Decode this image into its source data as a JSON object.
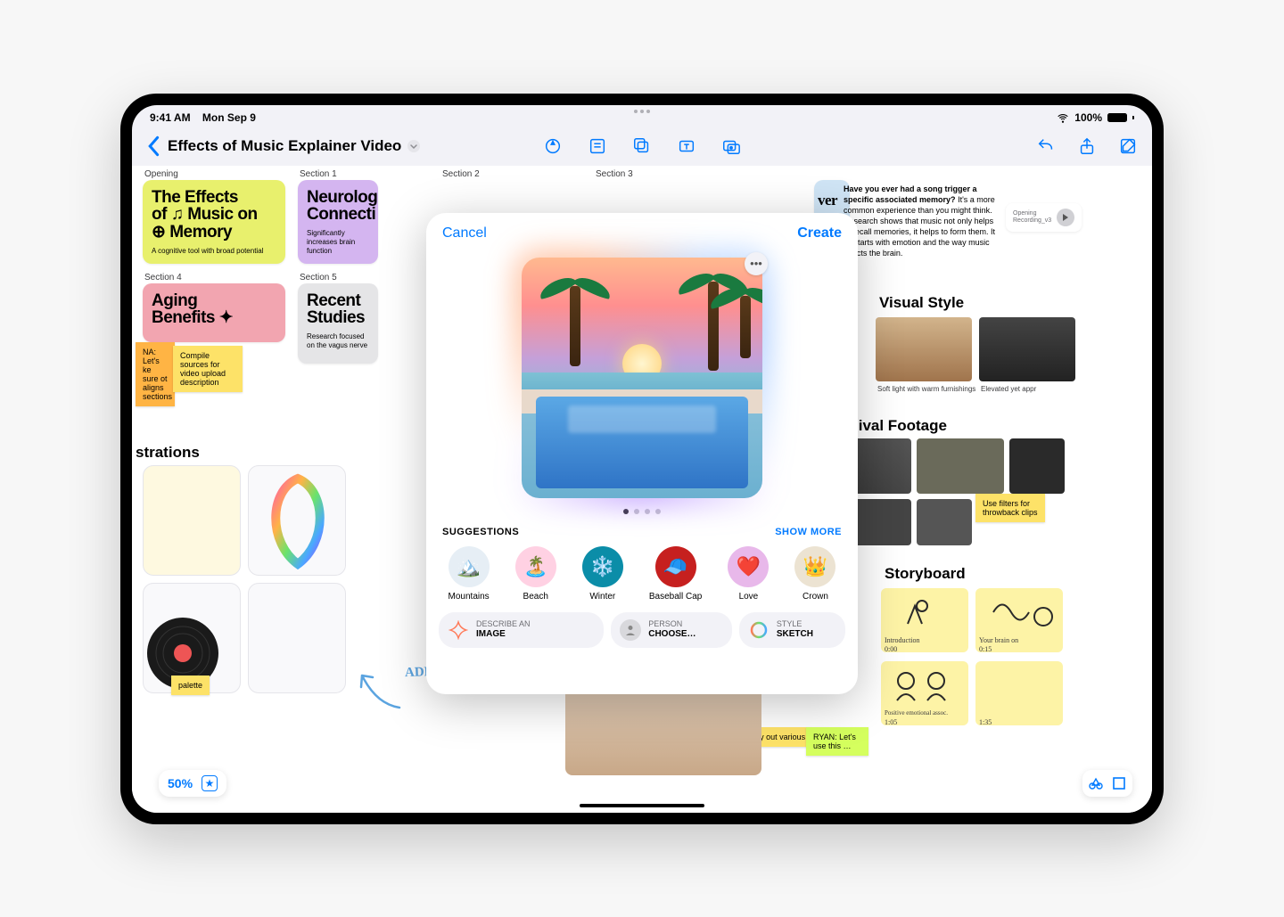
{
  "statusbar": {
    "time": "9:41 AM",
    "date": "Mon Sep 9",
    "battery_pct": "100%"
  },
  "toolbar": {
    "doc_title": "Effects of Music Explainer Video",
    "tools": [
      "annotate",
      "note",
      "shape",
      "text-box",
      "media"
    ],
    "right_tools": [
      "undo",
      "share",
      "compose"
    ]
  },
  "sections": {
    "opening": "Opening",
    "s1": "Section 1",
    "s2": "Section 2",
    "s3": "Section 3",
    "s4": "Section 4",
    "s5": "Section 5"
  },
  "notes": {
    "opening": {
      "title_l1": "The Effects",
      "title_l2": "of ♫ Music on",
      "title_l3": "⊕ Memory",
      "sub": "A cognitive tool with broad potential"
    },
    "s1": {
      "title_l1": "Neurolog",
      "title_l2": "Connecti",
      "sub": "Significantly increases brain function"
    },
    "s4": {
      "title_l1": "Aging",
      "title_l2": "Benefits ✦"
    },
    "s5": {
      "title_l1": "Recent",
      "title_l2": "Studies",
      "sub": "Research focused on the vagus nerve"
    },
    "ver": "ver"
  },
  "stickies": {
    "na": "NA: Let's ke sure ot aligns sections",
    "compile": "Compile sources for video upload description",
    "filters": "Use filters for throwback clips",
    "tryout": "Try out various",
    "ryan": "RYAN: Let's use this …"
  },
  "text_block": {
    "bold": "Have you ever had a song trigger a specific associated memory?",
    "rest": " It's a more common experience than you might think. Research shows that music not only helps to recall memories, it helps to form them. It all starts with emotion and the way music affects the brain."
  },
  "recording": {
    "label_l1": "Opening",
    "label_l2": "Recording_v3"
  },
  "headings": {
    "visual": "Visual Style",
    "archival": "Archival Footage",
    "storyboard": "Storyboard",
    "strations": "strations"
  },
  "captions": {
    "soft": "Soft light with warm furnishings",
    "elevated": "Elevated yet appr"
  },
  "story_cards": {
    "c1_l1": "Introduction",
    "c1_l2": "0:00",
    "c2_l1": "Your brain on",
    "c2_l2": "0:15",
    "c3_l1": "Positive emotional assoc.",
    "c3_l2": "1:05",
    "c4_l2": "1:35"
  },
  "palette": "palette",
  "hand_text": "ADD NEW IDEAS",
  "zoom": "50%",
  "modal": {
    "cancel": "Cancel",
    "create": "Create",
    "suggestions_label": "SUGGESTIONS",
    "show_more": "SHOW MORE",
    "suggestions": [
      {
        "label": "Mountains",
        "emoji": "🏔️",
        "bg": "#e6eef5"
      },
      {
        "label": "Beach",
        "emoji": "🏝️",
        "bg": "#ffd1e3"
      },
      {
        "label": "Winter",
        "emoji": "❄️",
        "bg": "#0b8da8"
      },
      {
        "label": "Baseball Cap",
        "emoji": "🧢",
        "bg": "#c6201f"
      },
      {
        "label": "Love",
        "emoji": "❤️",
        "bg": "#e8b8ea"
      },
      {
        "label": "Crown",
        "emoji": "👑",
        "bg": "#ece3d2"
      }
    ],
    "describe": {
      "label": "DESCRIBE AN",
      "value": "IMAGE"
    },
    "person": {
      "label": "PERSON",
      "value": "CHOOSE…"
    },
    "style": {
      "label": "STYLE",
      "value": "SKETCH"
    }
  }
}
